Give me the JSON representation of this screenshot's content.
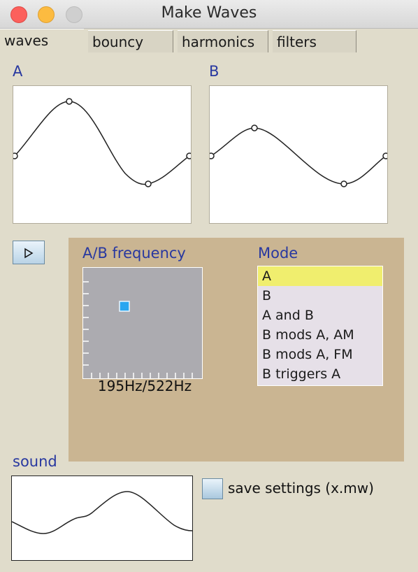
{
  "window": {
    "title": "Make Waves"
  },
  "tabs": [
    {
      "label": "waves",
      "active": true
    },
    {
      "label": "bouncy",
      "active": false
    },
    {
      "label": "harmonics",
      "active": false
    },
    {
      "label": "filters",
      "active": false
    }
  ],
  "waves": {
    "a_label": "A",
    "b_label": "B"
  },
  "play_icon": "play-triangle-icon",
  "frequency": {
    "label": "A/B frequency",
    "value": "195Hz/522Hz"
  },
  "mode": {
    "label": "Mode",
    "options": [
      "A",
      "B",
      "A and B",
      "B mods A, AM",
      "B mods A, FM",
      "B triggers A"
    ],
    "selected": "A"
  },
  "sound": {
    "label": "sound"
  },
  "settings": {
    "save_label": "save settings (x.mw)",
    "checked": false
  },
  "colors": {
    "label_blue": "#2838a0",
    "panel_tan": "#cab592",
    "selection_yellow": "#f0ee6e",
    "window_bg": "#e0dccb"
  }
}
